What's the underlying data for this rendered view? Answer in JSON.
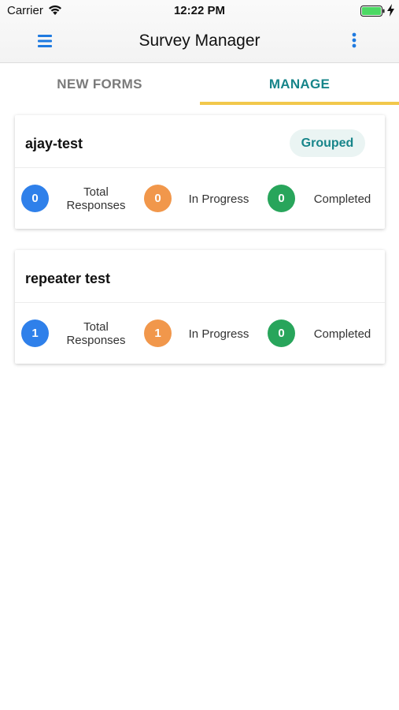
{
  "status_bar": {
    "carrier": "Carrier",
    "time": "12:22 PM"
  },
  "header": {
    "title": "Survey Manager"
  },
  "tabs": [
    {
      "label": "NEW FORMS",
      "active": false
    },
    {
      "label": "MANAGE",
      "active": true
    }
  ],
  "colors": {
    "accent": "#17858a",
    "tab_indicator": "#f2c84b",
    "total": "#2f80ea",
    "in_progress": "#f1974b",
    "completed": "#28a55b"
  },
  "forms": [
    {
      "title": "ajay-test",
      "badge": "Grouped",
      "stats": {
        "total": "0",
        "total_label_1": "Total",
        "total_label_2": "Responses",
        "in_progress": "0",
        "in_progress_label": "In Progress",
        "completed": "0",
        "completed_label": "Completed"
      }
    },
    {
      "title": "repeater test",
      "stats": {
        "total": "1",
        "total_label_1": "Total",
        "total_label_2": "Responses",
        "in_progress": "1",
        "in_progress_label": "In Progress",
        "completed": "0",
        "completed_label": "Completed"
      }
    }
  ]
}
